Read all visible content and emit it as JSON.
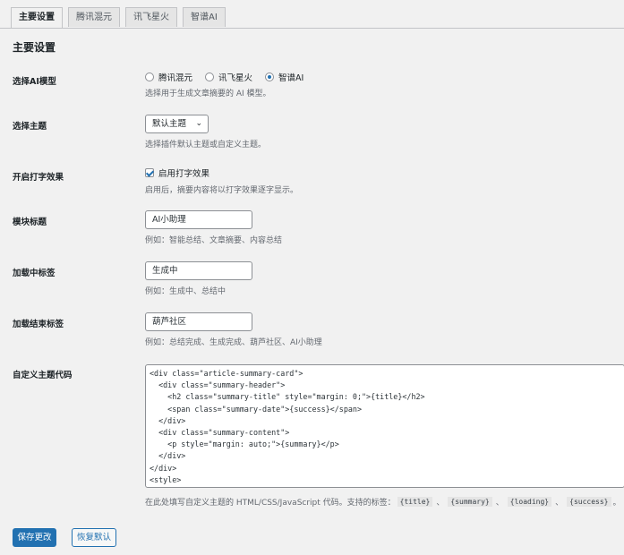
{
  "tabs": [
    {
      "label": "主要设置",
      "active": true
    },
    {
      "label": "腾讯混元",
      "active": false
    },
    {
      "label": "讯飞星火",
      "active": false
    },
    {
      "label": "智谱AI",
      "active": false
    }
  ],
  "section_title": "主要设置",
  "model": {
    "label": "选择AI模型",
    "options": [
      "腾讯混元",
      "讯飞星火",
      "智谱AI"
    ],
    "selected": "智谱AI",
    "desc": "选择用于生成文章摘要的 AI 模型。"
  },
  "theme": {
    "label": "选择主题",
    "value": "默认主题",
    "desc": "选择插件默认主题或自定义主题。"
  },
  "typing": {
    "label": "开启打字效果",
    "checkbox_label": "启用打字效果",
    "checked": true,
    "desc": "启用后，摘要内容将以打字效果逐字显示。"
  },
  "module_title": {
    "label": "模块标题",
    "value": "AI小助理",
    "desc": "例如：智能总结、文章摘要、内容总结"
  },
  "loading_label": {
    "label": "加载中标签",
    "value": "生成中",
    "desc": "例如：生成中、总结中"
  },
  "done_label": {
    "label": "加载结束标签",
    "value": "葫芦社区",
    "desc": "例如：总结完成、生成完成、葫芦社区、AI小助理"
  },
  "custom_code": {
    "label": "自定义主题代码",
    "code": "<div class=\"article-summary-card\">\n  <div class=\"summary-header\">\n    <h2 class=\"summary-title\" style=\"margin: 0;\">{title}</h2>\n    <span class=\"summary-date\">{success}</span>\n  </div>\n  <div class=\"summary-content\">\n    <p style=\"margin: auto;\">{summary}</p>\n  </div>\n</div>\n<style>",
    "desc_prefix": "在此处填写自定义主题的 HTML/CSS/JavaScript 代码。支持的标签：",
    "tags": [
      "{title}",
      "{summary}",
      "{loading}",
      "{success}"
    ],
    "sep": "、",
    "end": "。"
  },
  "buttons": {
    "save": "保存更改",
    "reset": "恢复默认"
  },
  "colors": {
    "accent": "#2271b1",
    "background": "#f1f1f1"
  }
}
